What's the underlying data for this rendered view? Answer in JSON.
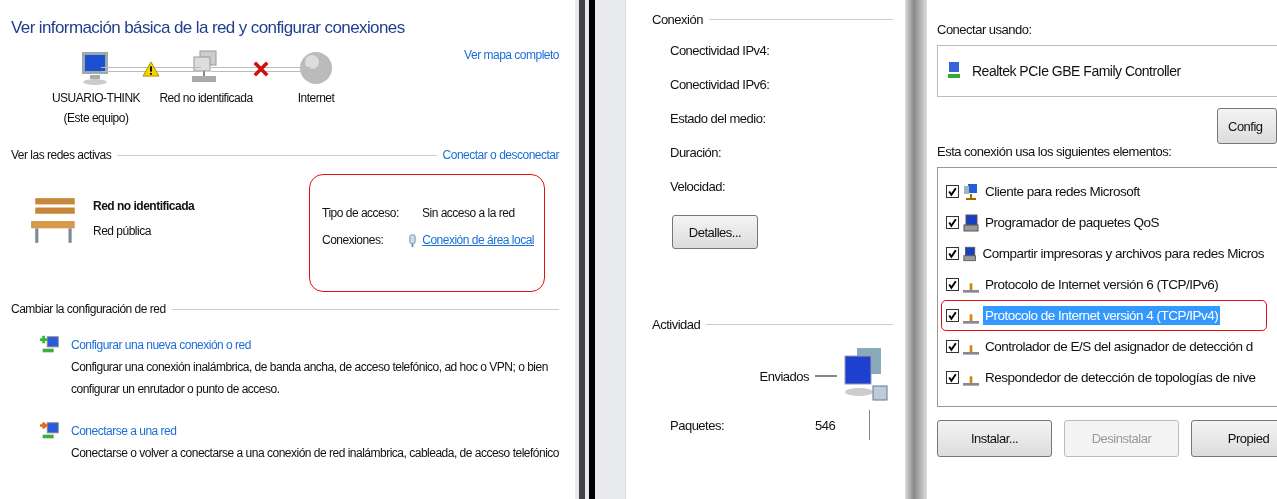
{
  "network_center": {
    "title": "Ver información básica de la red y configurar conexiones",
    "map_link": "Ver mapa completo",
    "nodes": [
      {
        "kind": "computer",
        "label": "USUARIO-THINK",
        "sublabel": "(Este equipo)"
      },
      {
        "kind": "network",
        "label": "Red no identificada"
      },
      {
        "kind": "globe",
        "label": "Internet"
      }
    ],
    "links": [
      {
        "kind": "warning"
      },
      {
        "kind": "error"
      }
    ],
    "active_networks": {
      "heading": "Ver las redes activas",
      "link": "Conectar o desconectar",
      "network_name": "Red no identificada",
      "network_type": "Red pública",
      "highlighted": true,
      "access_type_label": "Tipo de acceso:",
      "access_type": "Sin acceso a la red",
      "connections_label": "Conexiones:",
      "connection": "Conexión de área local"
    },
    "change_settings": {
      "heading": "Cambiar la configuración de red",
      "tasks": [
        {
          "kind": "new",
          "link": "Configurar una nueva conexión o red",
          "description": "Configurar una conexión inalámbrica, de banda ancha, de acceso telefónico, ad hoc o VPN; o bien configurar un enrutador o punto de acceso."
        },
        {
          "kind": "connect",
          "link": "Conectarse a una red",
          "description": "Conectarse o volver a conectarse a una conexión de red inalámbrica, cableada, de acceso telefónico"
        }
      ]
    }
  },
  "status_dialog": {
    "connection_heading": "Conexión",
    "fields": [
      "Conectividad IPv4:",
      "Conectividad IPv6:",
      "Estado del medio:",
      "Duración:",
      "Velocidad:"
    ],
    "details_button": "Detalles...",
    "activity_heading": "Actividad",
    "sent_label": "Enviados",
    "packets_label": "Paquetes:",
    "packets_sent": "546"
  },
  "properties_dialog": {
    "connect_using_label": "Conectar usando:",
    "adapter": "Realtek PCIe GBE Family Controller",
    "configure_button": "Config",
    "items_label": "Esta conexión usa los siguientes elementos:",
    "items": [
      {
        "kind": "client",
        "label": "Cliente para redes Microsoft",
        "checked": true,
        "selected": false,
        "highlighted": false
      },
      {
        "kind": "service",
        "label": "Programador de paquetes QoS",
        "checked": true,
        "selected": false,
        "highlighted": false
      },
      {
        "kind": "service",
        "label": "Compartir impresoras y archivos para redes Micros",
        "checked": true,
        "selected": false,
        "highlighted": false
      },
      {
        "kind": "protocol",
        "label": "Protocolo de Internet versión 6 (TCP/IPv6)",
        "checked": true,
        "selected": false,
        "highlighted": false
      },
      {
        "kind": "protocol",
        "label": "Protocolo de Internet versión 4 (TCP/IPv4)",
        "checked": true,
        "selected": true,
        "highlighted": true
      },
      {
        "kind": "protocol",
        "label": "Controlador de E/S del asignador de detección d",
        "checked": true,
        "selected": false,
        "highlighted": false
      },
      {
        "kind": "protocol",
        "label": "Respondedor de detección de topologías de nive",
        "checked": true,
        "selected": false,
        "highlighted": false
      }
    ],
    "buttons": [
      {
        "label": "Instalar...",
        "disabled": false
      },
      {
        "label": "Desinstalar",
        "disabled": true
      },
      {
        "label": "Propied",
        "disabled": false
      }
    ]
  }
}
